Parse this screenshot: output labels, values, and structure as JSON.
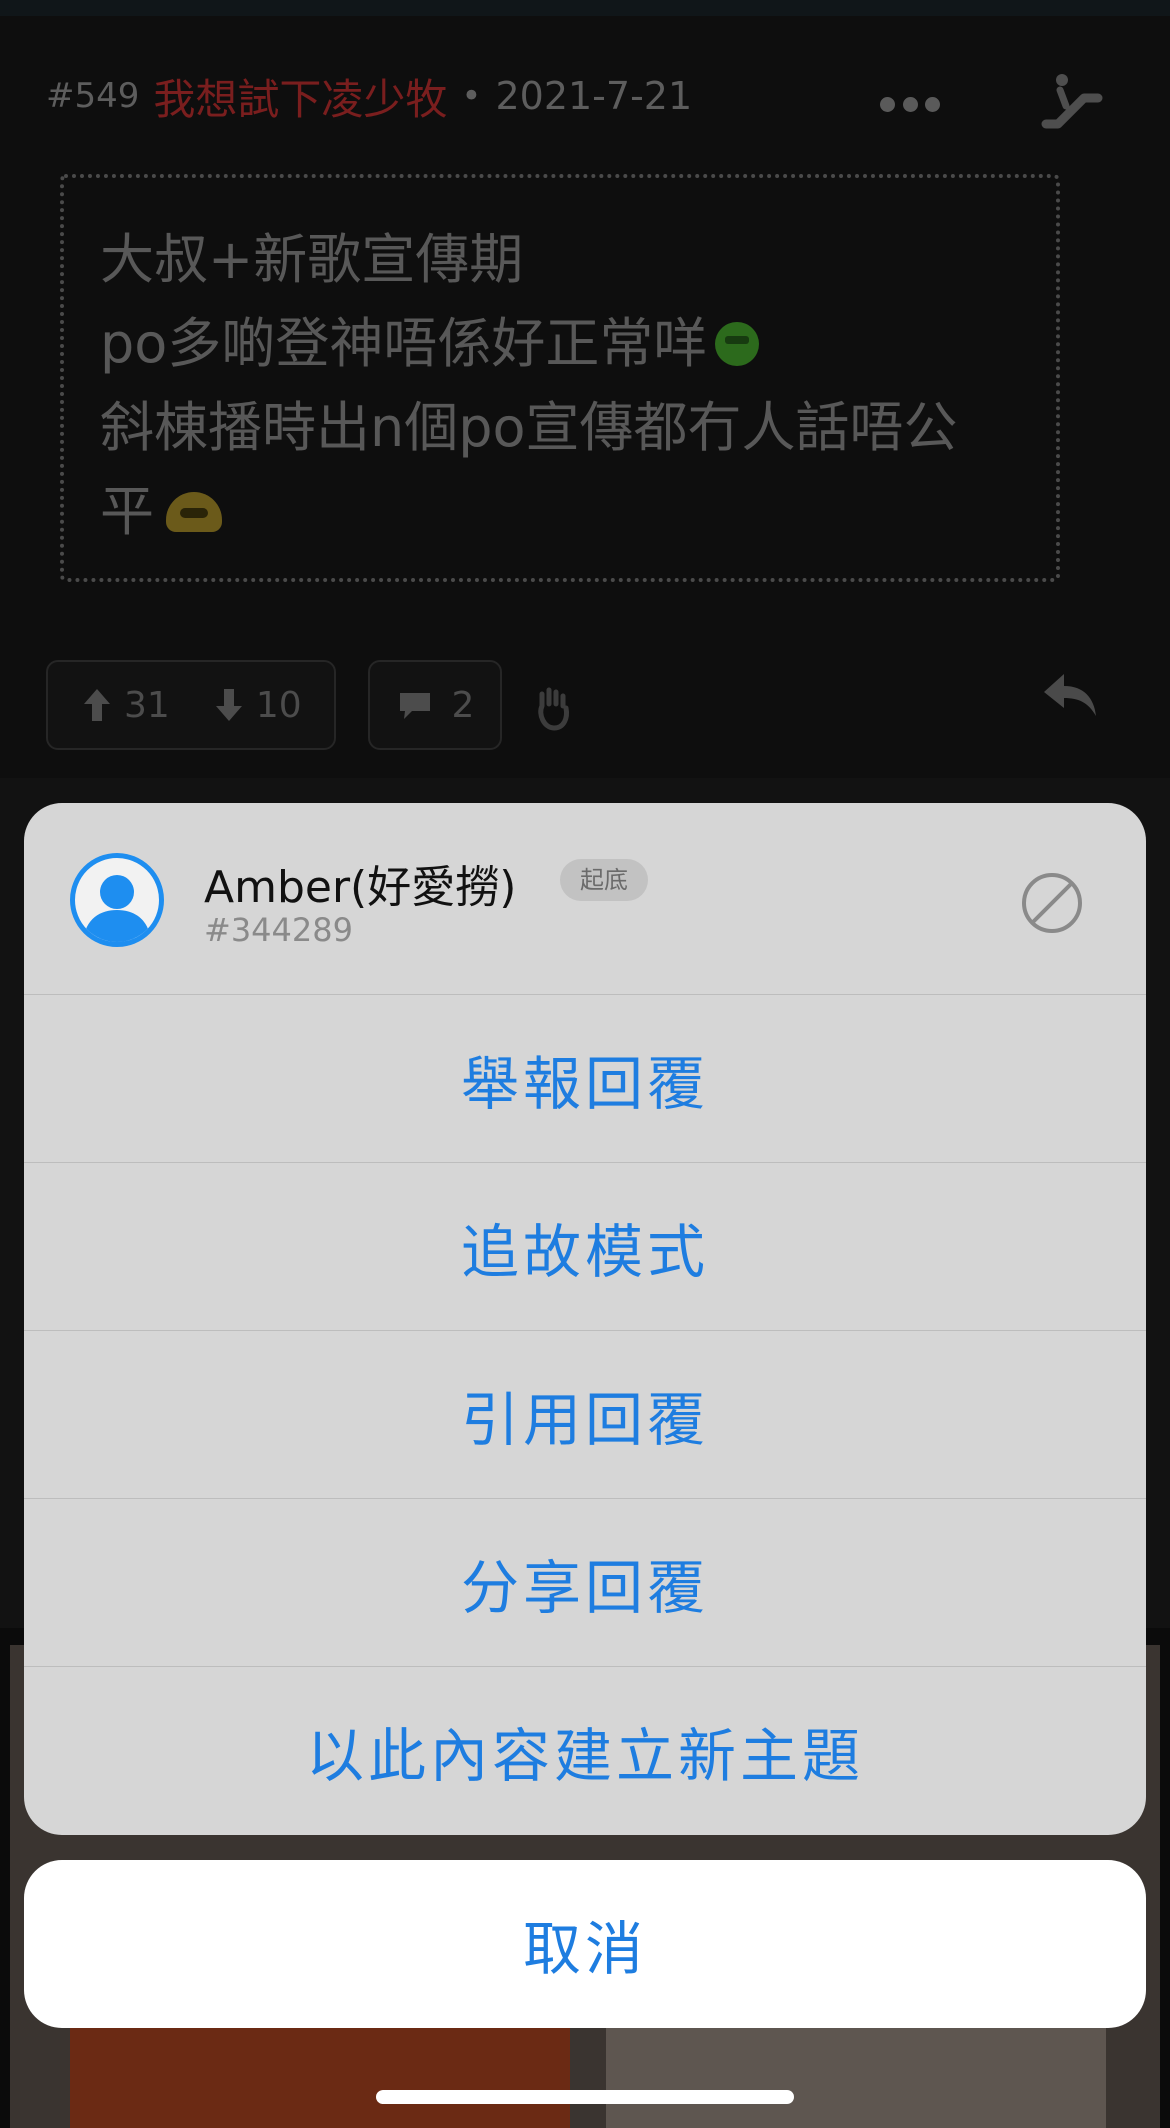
{
  "post": {
    "number": "#549",
    "author": "我想試下凌少牧",
    "separator": "•",
    "date": "2021-7-21",
    "content_lines": [
      "大叔+新歌宣傳期",
      "po多啲登神唔係好正常咩",
      "斜棟播時出n個po宣傳都冇人話唔公",
      "平"
    ],
    "upvotes": "31",
    "downvotes": "10",
    "comments": "2"
  },
  "sheet": {
    "username": "Amber(好愛撈)",
    "badge": "起底",
    "user_id": "#344289",
    "actions": [
      "舉報回覆",
      "追故模式",
      "引用回覆",
      "分享回覆",
      "以此內容建立新主題"
    ],
    "cancel": "取消"
  },
  "colors": {
    "accent": "#1e7de0",
    "avatar_ring": "#1e8ef0",
    "author_red": "#7a1e1e"
  }
}
